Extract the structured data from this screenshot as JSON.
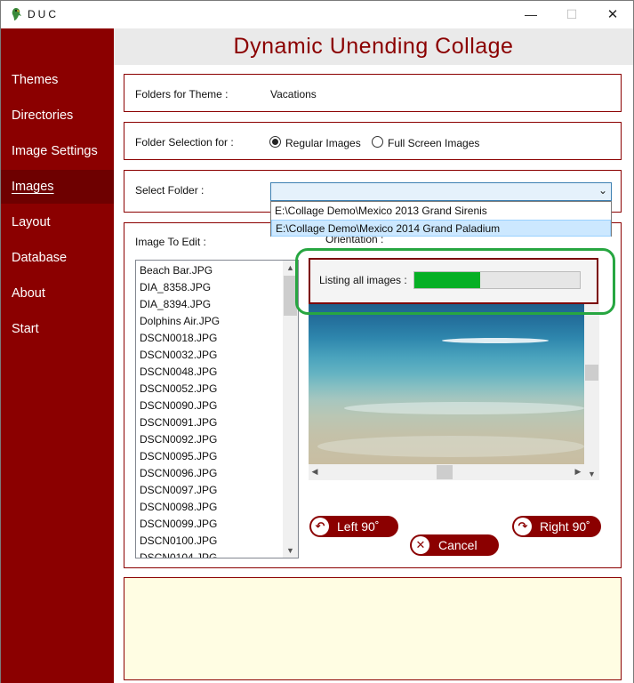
{
  "window": {
    "title": "DUC",
    "app_icon": "parrot-icon"
  },
  "sidebar": {
    "items": [
      {
        "label": "Themes"
      },
      {
        "label": "Directories"
      },
      {
        "label": "Image Settings"
      },
      {
        "label": "Images"
      },
      {
        "label": "Layout"
      },
      {
        "label": "Database"
      },
      {
        "label": "About"
      },
      {
        "label": "Start"
      }
    ],
    "active": "Images"
  },
  "header": {
    "title": "Dynamic Unending Collage"
  },
  "folders_for_theme": {
    "label": "Folders for Theme :",
    "value": "Vacations"
  },
  "folder_selection": {
    "label": "Folder Selection for :",
    "options": [
      {
        "label": "Regular Images",
        "checked": true
      },
      {
        "label": "Full Screen Images",
        "checked": false
      }
    ]
  },
  "select_folder": {
    "label": "Select Folder :",
    "value": "",
    "dropdown_items": [
      "E:\\Collage Demo\\Mexico 2013 Grand Sirenis",
      "E:\\Collage Demo\\Mexico 2014 Grand Paladium"
    ],
    "highlighted_index": 1
  },
  "image_to_edit": {
    "label": "Image To Edit :",
    "files": [
      "Beach Bar.JPG",
      "DIA_8358.JPG",
      "DIA_8394.JPG",
      "Dolphins Air.JPG",
      "DSCN0018.JPG",
      "DSCN0032.JPG",
      "DSCN0048.JPG",
      "DSCN0052.JPG",
      "DSCN0090.JPG",
      "DSCN0091.JPG",
      "DSCN0092.JPG",
      "DSCN0095.JPG",
      "DSCN0096.JPG",
      "DSCN0097.JPG",
      "DSCN0098.JPG",
      "DSCN0099.JPG",
      "DSCN0100.JPG",
      "DSCN0104.JPG"
    ]
  },
  "orientation": {
    "label": "Orientation :"
  },
  "progress": {
    "label": "Listing all images :",
    "fraction": 0.4
  },
  "buttons": {
    "left": "Left 90˚",
    "right": "Right 90˚",
    "cancel": "Cancel"
  },
  "colors": {
    "brand": "#8b0000",
    "progress": "#06b025",
    "highlight": "#27a641",
    "note_bg": "#fffde3"
  }
}
